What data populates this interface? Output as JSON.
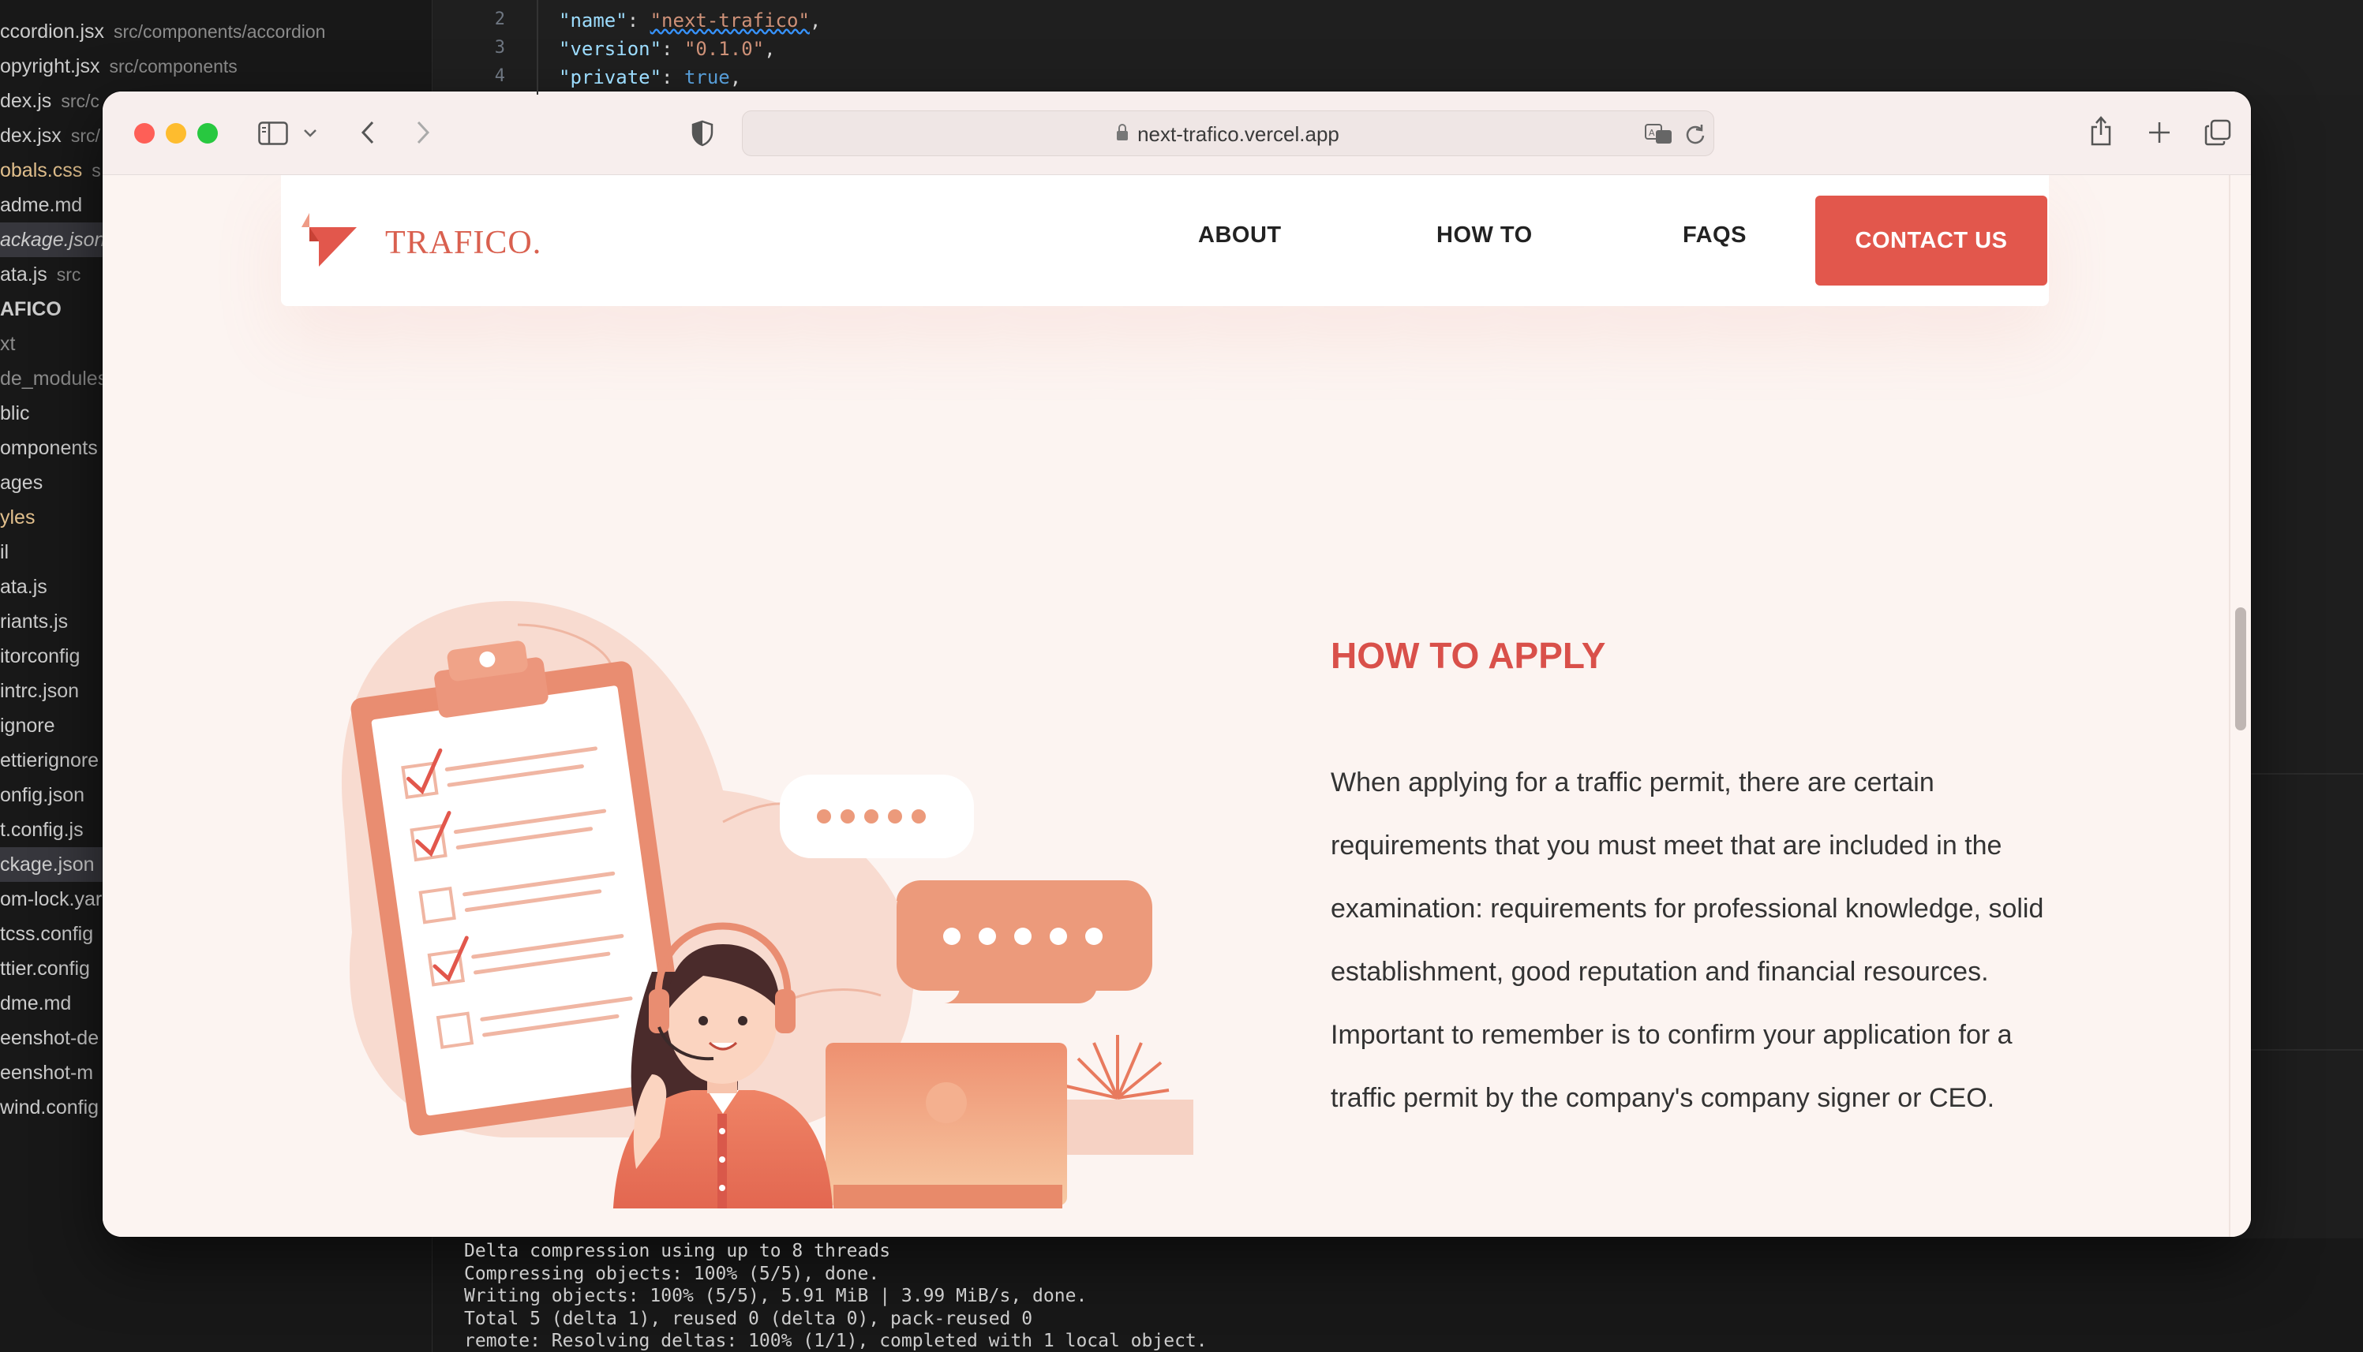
{
  "editor": {
    "explorer_items": [
      {
        "name": "ccordion.jsx",
        "path": "src/components/accordion"
      },
      {
        "name": "opyright.jsx",
        "path": "src/components"
      },
      {
        "name": "dex.js",
        "path": "src/c"
      },
      {
        "name": "dex.jsx",
        "path": "src/"
      },
      {
        "name": "obals.css",
        "path": "s"
      },
      {
        "name": "adme.md",
        "path": ""
      },
      {
        "name": "ackage.json",
        "path": ""
      },
      {
        "name": "ata.js",
        "path": "src"
      },
      {
        "name": "AFICO",
        "path": ""
      },
      {
        "name": "xt",
        "path": ""
      },
      {
        "name": "de_modules",
        "path": ""
      },
      {
        "name": "blic",
        "path": ""
      },
      {
        "name": "omponents",
        "path": ""
      },
      {
        "name": "ages",
        "path": ""
      },
      {
        "name": "yles",
        "path": ""
      },
      {
        "name": "il",
        "path": ""
      },
      {
        "name": "ata.js",
        "path": ""
      },
      {
        "name": "riants.js",
        "path": ""
      },
      {
        "name": "itorconfig",
        "path": ""
      },
      {
        "name": "intrc.json",
        "path": ""
      },
      {
        "name": "ignore",
        "path": ""
      },
      {
        "name": "ettierignore",
        "path": ""
      },
      {
        "name": "onfig.json",
        "path": ""
      },
      {
        "name": "t.config.js",
        "path": ""
      },
      {
        "name": "ckage.json",
        "path": ""
      },
      {
        "name": "om-lock.yar",
        "path": ""
      },
      {
        "name": "tcss.config",
        "path": ""
      },
      {
        "name": "ttier.config",
        "path": ""
      },
      {
        "name": "dme.md",
        "path": ""
      },
      {
        "name": "eenshot-de",
        "path": ""
      },
      {
        "name": "eenshot-m",
        "path": ""
      },
      {
        "name": "wind.config",
        "path": ""
      }
    ],
    "code_lines": [
      {
        "num": "2",
        "key": "\"name\"",
        "value": "\"next-trafico\""
      },
      {
        "num": "3",
        "key": "\"version\"",
        "value": "\"0.1.0\""
      },
      {
        "num": "4",
        "key": "\"private\"",
        "value": "true"
      }
    ],
    "terminal_lines": [
      "Delta compression using up to 8 threads",
      "Compressing objects: 100% (5/5), done.",
      "Writing objects: 100% (5/5), 5.91 MiB | 3.99 MiB/s, done.",
      "Total 5 (delta 1), reused 0 (delta 0), pack-reused 0",
      "remote: Resolving deltas: 100% (1/1), completed with 1 local object."
    ]
  },
  "browser": {
    "url": "next-trafico.vercel.app",
    "icons": {
      "sidebar": "sidebar-icon",
      "back": "back-icon",
      "forward": "forward-icon",
      "shield": "shield-icon",
      "translate": "translate-icon",
      "reload": "reload-icon",
      "share": "share-icon",
      "new_tab": "plus-icon",
      "tabs": "tabs-overview-icon"
    }
  },
  "site": {
    "logo_text": "TRAFICO.",
    "nav": [
      "ABOUT",
      "HOW TO",
      "FAQS"
    ],
    "contact_label": "CONTACT US",
    "section_title": "HOW TO APPLY",
    "section_body": "When applying for a traffic permit, there are certain requirements that you must meet that are included in the examination: requirements for professional knowledge, solid establishment, good reputation and financial resources. Important to remember is to confirm your application for a traffic permit by the company's company signer or CEO.",
    "colors": {
      "accent": "#e2574c",
      "title": "#d9504a",
      "logo": "#d9604f",
      "background": "#fcf4f1"
    }
  }
}
